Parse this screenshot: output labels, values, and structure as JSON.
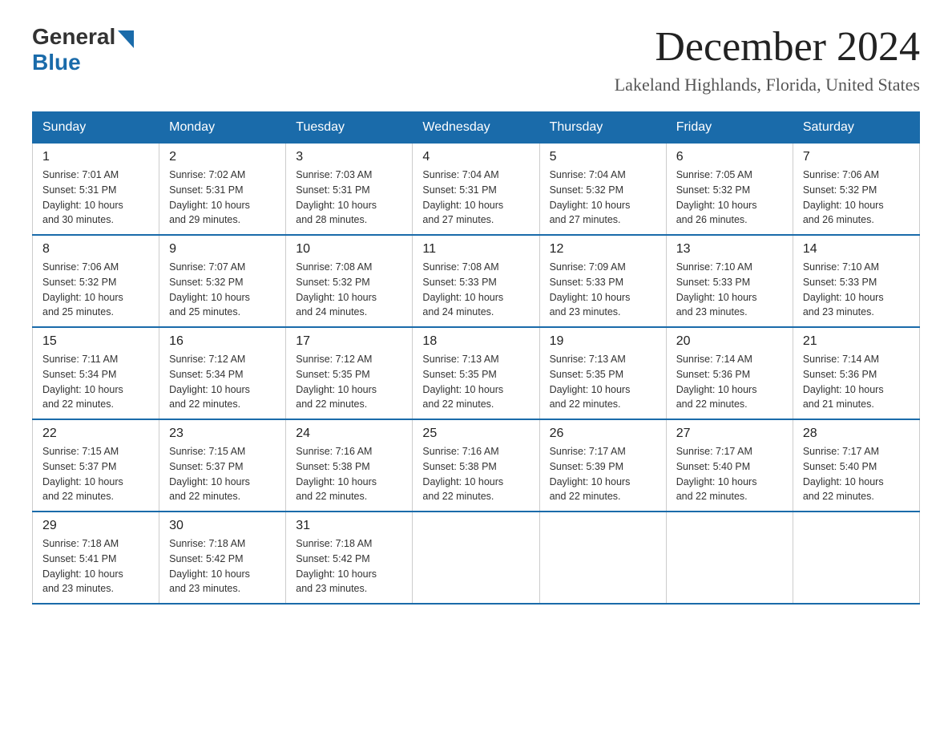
{
  "header": {
    "logo_general": "General",
    "logo_blue": "Blue",
    "title": "December 2024",
    "subtitle": "Lakeland Highlands, Florida, United States"
  },
  "days_of_week": [
    "Sunday",
    "Monday",
    "Tuesday",
    "Wednesday",
    "Thursday",
    "Friday",
    "Saturday"
  ],
  "weeks": [
    [
      {
        "day": "1",
        "sunrise": "7:01 AM",
        "sunset": "5:31 PM",
        "daylight": "10 hours and 30 minutes."
      },
      {
        "day": "2",
        "sunrise": "7:02 AM",
        "sunset": "5:31 PM",
        "daylight": "10 hours and 29 minutes."
      },
      {
        "day": "3",
        "sunrise": "7:03 AM",
        "sunset": "5:31 PM",
        "daylight": "10 hours and 28 minutes."
      },
      {
        "day": "4",
        "sunrise": "7:04 AM",
        "sunset": "5:31 PM",
        "daylight": "10 hours and 27 minutes."
      },
      {
        "day": "5",
        "sunrise": "7:04 AM",
        "sunset": "5:32 PM",
        "daylight": "10 hours and 27 minutes."
      },
      {
        "day": "6",
        "sunrise": "7:05 AM",
        "sunset": "5:32 PM",
        "daylight": "10 hours and 26 minutes."
      },
      {
        "day": "7",
        "sunrise": "7:06 AM",
        "sunset": "5:32 PM",
        "daylight": "10 hours and 26 minutes."
      }
    ],
    [
      {
        "day": "8",
        "sunrise": "7:06 AM",
        "sunset": "5:32 PM",
        "daylight": "10 hours and 25 minutes."
      },
      {
        "day": "9",
        "sunrise": "7:07 AM",
        "sunset": "5:32 PM",
        "daylight": "10 hours and 25 minutes."
      },
      {
        "day": "10",
        "sunrise": "7:08 AM",
        "sunset": "5:32 PM",
        "daylight": "10 hours and 24 minutes."
      },
      {
        "day": "11",
        "sunrise": "7:08 AM",
        "sunset": "5:33 PM",
        "daylight": "10 hours and 24 minutes."
      },
      {
        "day": "12",
        "sunrise": "7:09 AM",
        "sunset": "5:33 PM",
        "daylight": "10 hours and 23 minutes."
      },
      {
        "day": "13",
        "sunrise": "7:10 AM",
        "sunset": "5:33 PM",
        "daylight": "10 hours and 23 minutes."
      },
      {
        "day": "14",
        "sunrise": "7:10 AM",
        "sunset": "5:33 PM",
        "daylight": "10 hours and 23 minutes."
      }
    ],
    [
      {
        "day": "15",
        "sunrise": "7:11 AM",
        "sunset": "5:34 PM",
        "daylight": "10 hours and 22 minutes."
      },
      {
        "day": "16",
        "sunrise": "7:12 AM",
        "sunset": "5:34 PM",
        "daylight": "10 hours and 22 minutes."
      },
      {
        "day": "17",
        "sunrise": "7:12 AM",
        "sunset": "5:35 PM",
        "daylight": "10 hours and 22 minutes."
      },
      {
        "day": "18",
        "sunrise": "7:13 AM",
        "sunset": "5:35 PM",
        "daylight": "10 hours and 22 minutes."
      },
      {
        "day": "19",
        "sunrise": "7:13 AM",
        "sunset": "5:35 PM",
        "daylight": "10 hours and 22 minutes."
      },
      {
        "day": "20",
        "sunrise": "7:14 AM",
        "sunset": "5:36 PM",
        "daylight": "10 hours and 22 minutes."
      },
      {
        "day": "21",
        "sunrise": "7:14 AM",
        "sunset": "5:36 PM",
        "daylight": "10 hours and 21 minutes."
      }
    ],
    [
      {
        "day": "22",
        "sunrise": "7:15 AM",
        "sunset": "5:37 PM",
        "daylight": "10 hours and 22 minutes."
      },
      {
        "day": "23",
        "sunrise": "7:15 AM",
        "sunset": "5:37 PM",
        "daylight": "10 hours and 22 minutes."
      },
      {
        "day": "24",
        "sunrise": "7:16 AM",
        "sunset": "5:38 PM",
        "daylight": "10 hours and 22 minutes."
      },
      {
        "day": "25",
        "sunrise": "7:16 AM",
        "sunset": "5:38 PM",
        "daylight": "10 hours and 22 minutes."
      },
      {
        "day": "26",
        "sunrise": "7:17 AM",
        "sunset": "5:39 PM",
        "daylight": "10 hours and 22 minutes."
      },
      {
        "day": "27",
        "sunrise": "7:17 AM",
        "sunset": "5:40 PM",
        "daylight": "10 hours and 22 minutes."
      },
      {
        "day": "28",
        "sunrise": "7:17 AM",
        "sunset": "5:40 PM",
        "daylight": "10 hours and 22 minutes."
      }
    ],
    [
      {
        "day": "29",
        "sunrise": "7:18 AM",
        "sunset": "5:41 PM",
        "daylight": "10 hours and 23 minutes."
      },
      {
        "day": "30",
        "sunrise": "7:18 AM",
        "sunset": "5:42 PM",
        "daylight": "10 hours and 23 minutes."
      },
      {
        "day": "31",
        "sunrise": "7:18 AM",
        "sunset": "5:42 PM",
        "daylight": "10 hours and 23 minutes."
      },
      null,
      null,
      null,
      null
    ]
  ],
  "labels": {
    "sunrise": "Sunrise:",
    "sunset": "Sunset:",
    "daylight": "Daylight:"
  }
}
